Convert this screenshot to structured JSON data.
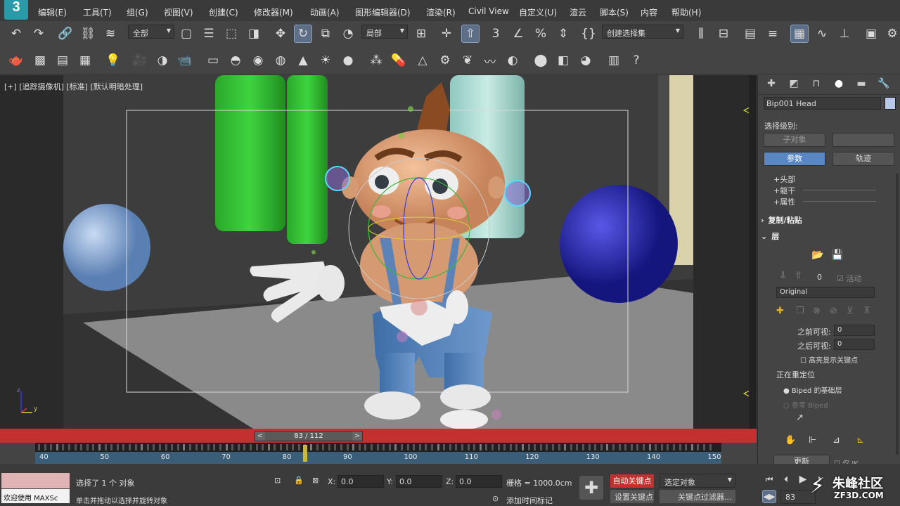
{
  "app": {
    "logo_text": "3",
    "accent": "#2a9aa8"
  },
  "menus": [
    "编辑(E)",
    "工具(T)",
    "组(G)",
    "视图(V)",
    "创建(C)",
    "修改器(M)",
    "动画(A)",
    "图形编辑器(D)",
    "渲染(R)",
    "Civil View",
    "自定义(U)",
    "渲云",
    "脚本(S)",
    "内容",
    "帮助(H)"
  ],
  "toolbar": {
    "selection_filter": "全部",
    "ref_coord": "局部",
    "named_selection": "创建选择集"
  },
  "viewport": {
    "label": "[+] [追踪摄像机] [标准] [默认明暗处理]",
    "axis_y": "y",
    "axis_z": "z"
  },
  "time_slider": {
    "text": "83 / 112",
    "prev": "<",
    "next": ">"
  },
  "trackbar": {
    "labels": [
      "40",
      "50",
      "60",
      "70",
      "80",
      "90",
      "100",
      "110",
      "120",
      "130",
      "140",
      "150"
    ],
    "current": 83
  },
  "status": {
    "selected": "选择了 1 个 对象",
    "hint": "单击并拖动以选择并旋转对象",
    "welcome": "欢迎使用 MAXSc",
    "x_label": "X:",
    "x_value": "0.0",
    "y_label": "Y:",
    "y_value": "0.0",
    "z_label": "Z:",
    "z_value": "0.0",
    "grid": "栅格 = 1000.0cm",
    "add_time_tag": "添加时间标记",
    "auto_key": "自动关键点",
    "set_key": "设置关键点",
    "key_target": "选定对象",
    "key_filters": "关键点过滤器...",
    "frame": "83"
  },
  "panel": {
    "object_name": "Bip001 Head",
    "selection_level": "选择级别:",
    "sub_object": "子对象",
    "params": "参数",
    "trajectory": "轨迹",
    "rollouts": [
      "+头部",
      "+躯干",
      "+属性"
    ],
    "copy_paste": "复制/粘贴",
    "layers": "层",
    "layer_num": "0",
    "active": "活动",
    "layer_name": "Original",
    "before_visible": "之前可视:",
    "before_value": "0",
    "after_visible": "之后可视:",
    "after_value": "0",
    "highlight_keys": "高亮显示关键点",
    "retarget": "正在重定位",
    "biped_base": "Biped 的基础层",
    "ref_biped": "参考 Biped",
    "update": "更新",
    "ik_only": "仅 IK"
  },
  "watermark": {
    "line1": "朱峰社区",
    "line2": "ZF3D.COM"
  }
}
